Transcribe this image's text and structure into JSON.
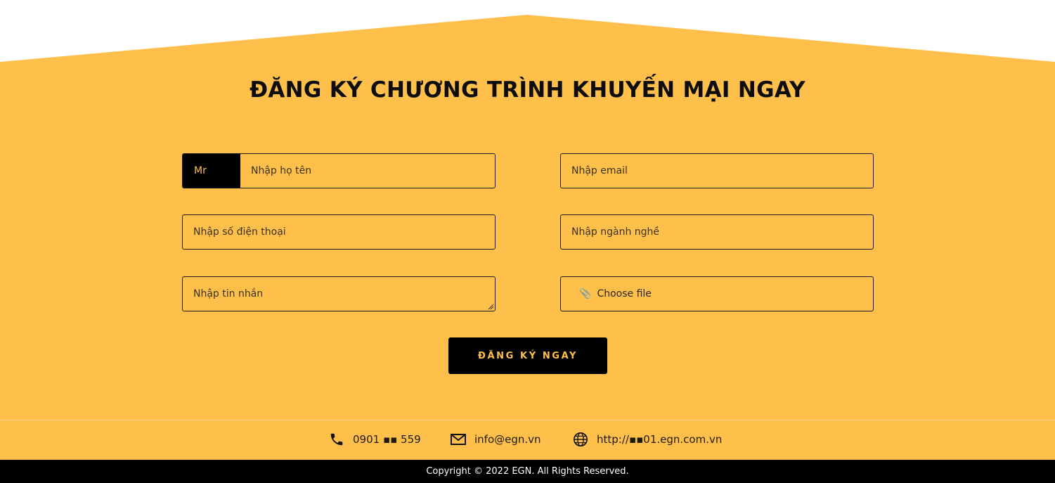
{
  "colors": {
    "accent": "#fec04b",
    "dark": "#000000",
    "page": "#ffffff"
  },
  "form": {
    "title": "ĐĂNG KÝ CHƯƠNG TRÌNH KHUYẾN MẠI NGAY",
    "salutation": "Mr",
    "name_placeholder": "Nhập họ tên",
    "email_placeholder": "Nhập email",
    "phone_placeholder": "Nhập số điện thoại",
    "industry_placeholder": "Nhập ngành nghề",
    "message_placeholder": "Nhập tin nhắn",
    "file_label": "Choose file",
    "submit_label": "ĐĂNG KÝ NGAY"
  },
  "contact": {
    "phone": "0901 ▪▪ 559",
    "email": "info@egn.vn",
    "website": "http://▪▪01.egn.com.vn",
    "icons": [
      "phone-icon",
      "mail-icon",
      "globe-icon"
    ]
  },
  "footer": {
    "copyright": "Copyright © 2022 EGN. All Rights Reserved."
  }
}
